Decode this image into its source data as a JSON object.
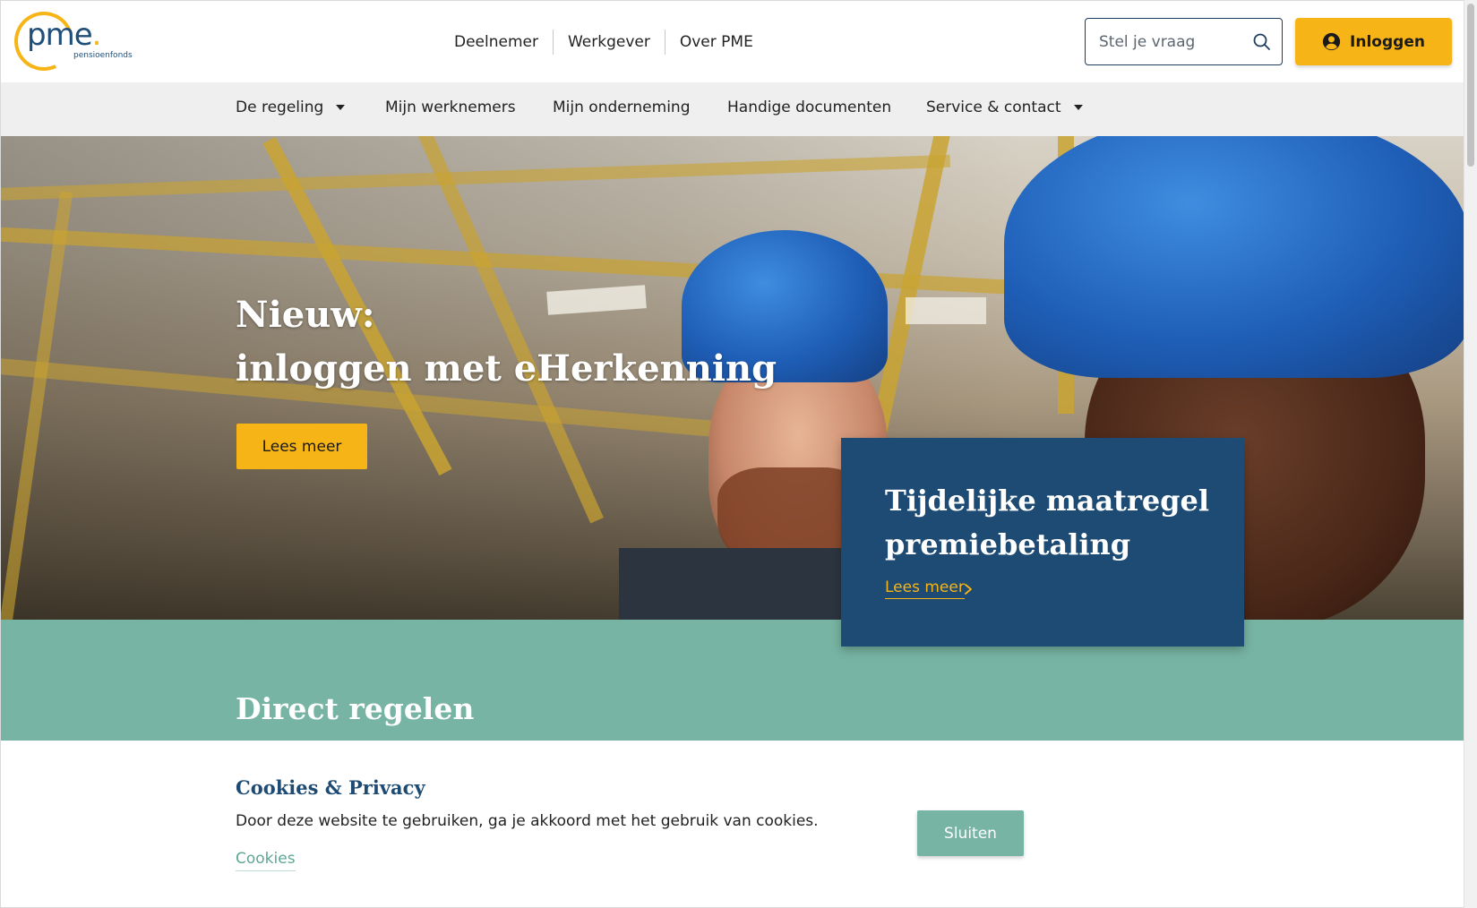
{
  "brand": {
    "logo_text": "pme",
    "logo_dot": ".",
    "logo_subtitle": "pensioenfonds",
    "accent": "#f7b416",
    "navy": "#1d4b74",
    "teal": "#77b4a3"
  },
  "topnav": {
    "items": [
      {
        "label": "Deelnemer"
      },
      {
        "label": "Werkgever"
      },
      {
        "label": "Over PME"
      }
    ]
  },
  "search": {
    "placeholder": "Stel je vraag",
    "icon": "search-icon"
  },
  "login": {
    "label": "Inloggen",
    "icon": "user-circle-icon"
  },
  "subnav": {
    "items": [
      {
        "label": "De regeling",
        "has_dropdown": true
      },
      {
        "label": "Mijn werknemers",
        "has_dropdown": false
      },
      {
        "label": "Mijn onderneming",
        "has_dropdown": false
      },
      {
        "label": "Handige documenten",
        "has_dropdown": false
      },
      {
        "label": "Service & contact",
        "has_dropdown": true
      }
    ]
  },
  "hero": {
    "title_line1": "Nieuw:",
    "title_line2": "inloggen met eHerkenning",
    "button_label": "Lees meer"
  },
  "card": {
    "title": "Tijdelijke maatregel premiebetaling",
    "link_label": "Lees meer",
    "link_icon": "chevron-right-icon"
  },
  "band": {
    "title": "Direct regelen"
  },
  "cookie": {
    "title": "Cookies & Privacy",
    "text": "Door deze website te gebruiken, ga je akkoord met het gebruik van cookies.",
    "link_label": "Cookies",
    "button_label": "Sluiten"
  }
}
